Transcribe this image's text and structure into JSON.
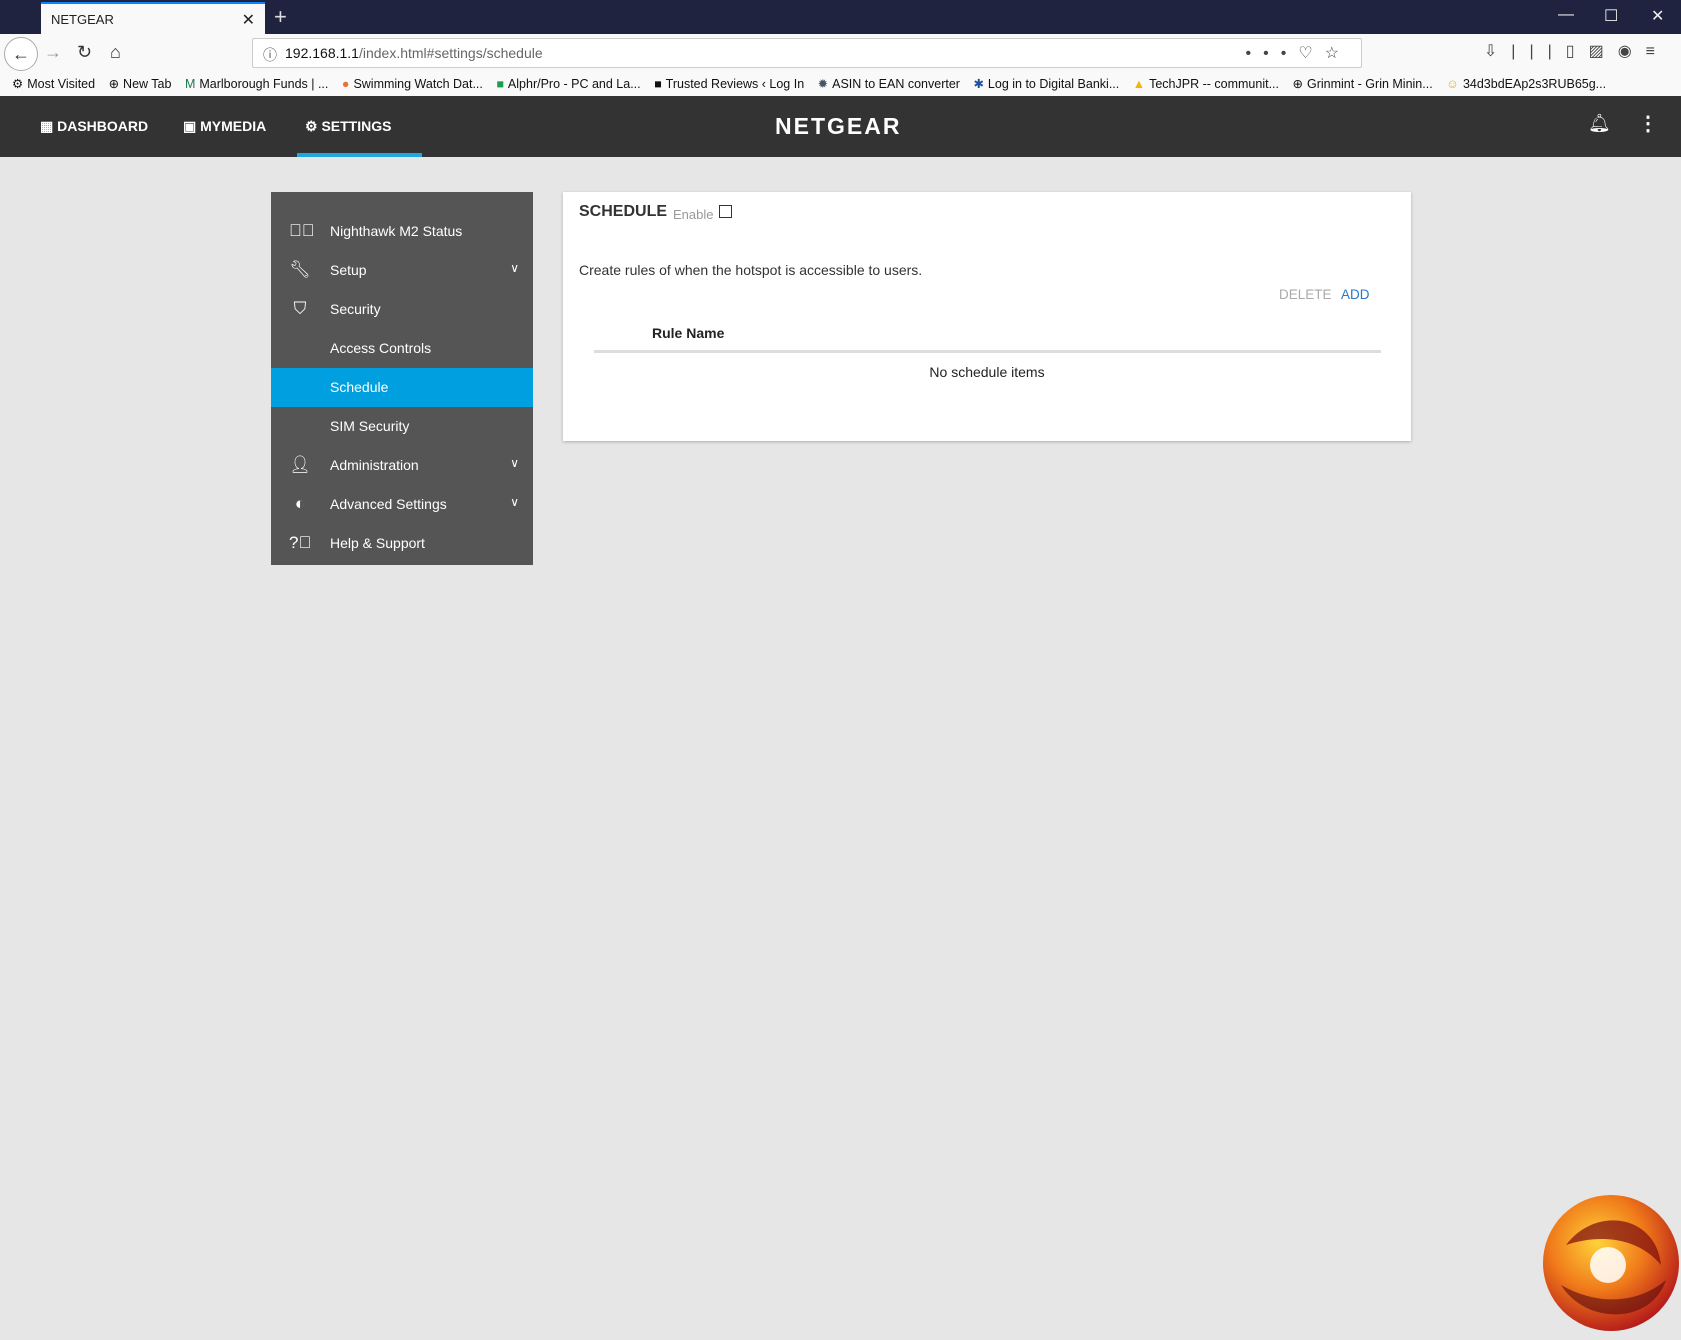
{
  "browser": {
    "tab_title": "NETGEAR",
    "url_host": "192.168.1.1",
    "url_path": "/index.html#settings/schedule",
    "bookmarks": [
      "Most Visited",
      "New Tab",
      "Marlborough Funds | ...",
      "Swimming Watch Dat...",
      "Alphr/Pro - PC and La...",
      "Trusted Reviews ‹ Log In",
      "ASIN to EAN converter",
      "Log in to Digital Banki...",
      "TechJPR -- communit...",
      "Grinmint - Grin Minin...",
      "34d3bdEAp2s3RUB65g..."
    ]
  },
  "nav": {
    "dashboard": "DASHBOARD",
    "mymedia": "MYMEDIA",
    "settings": "SETTINGS",
    "logo": "NETGEAR",
    "accent": "#1fa7e1"
  },
  "sidebar": {
    "items": [
      {
        "label": "Nighthawk M2 Status",
        "icon": "check-circle-icon"
      },
      {
        "label": "Setup",
        "icon": "wrench-icon"
      },
      {
        "label": "Security",
        "icon": "shield-icon"
      },
      {
        "label": "Access Controls"
      },
      {
        "label": "Schedule",
        "active": true
      },
      {
        "label": "SIM Security"
      },
      {
        "label": "Administration",
        "icon": "person-icon"
      },
      {
        "label": "Advanced Settings",
        "icon": "toggle-icon"
      },
      {
        "label": "Help & Support",
        "icon": "help-icon"
      }
    ],
    "active_color": "#009fe0"
  },
  "panel": {
    "title": "SCHEDULE",
    "enable_label": "Enable",
    "enabled": false,
    "description": "Create rules of when the hotspot is accessible to users.",
    "delete_label": "DELETE",
    "add_label": "ADD",
    "column_rule_name": "Rule Name",
    "empty_text": "No schedule items"
  }
}
